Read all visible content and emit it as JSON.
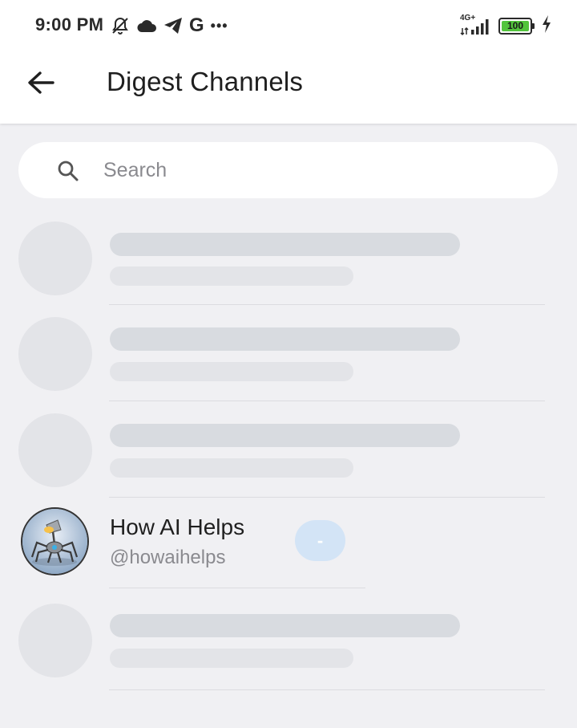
{
  "status_bar": {
    "time": "9:00 PM",
    "left_icons": [
      "mute-alarm-icon",
      "cloud-icon",
      "telegram-icon",
      "google-icon",
      "more-dots-icon"
    ],
    "google_letter": "G",
    "more_dots": "•••",
    "network_label": "4G+",
    "battery_level": "100",
    "charging": true
  },
  "header": {
    "back_icon": "arrow-left-icon",
    "title": "Digest Channels"
  },
  "search": {
    "placeholder": "Search",
    "value": ""
  },
  "channels": [
    {
      "loading": true
    },
    {
      "loading": true
    },
    {
      "loading": true
    },
    {
      "loading": false,
      "name": "How AI Helps",
      "handle": "@howaihelps",
      "badge": "-"
    },
    {
      "loading": true
    }
  ],
  "colors": {
    "background": "#f0f0f3",
    "app_bar": "#ffffff",
    "skeleton_primary": "#d8dbe0",
    "skeleton_secondary": "#e3e4e8",
    "badge_bg": "#d3e4f6",
    "battery_fill": "#52c43c"
  }
}
